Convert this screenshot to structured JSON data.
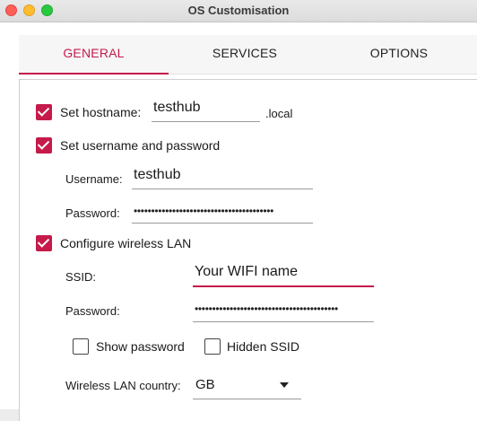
{
  "window": {
    "title": "OS Customisation"
  },
  "tabs": [
    {
      "label": "GENERAL",
      "active": true
    },
    {
      "label": "SERVICES",
      "active": false
    },
    {
      "label": "OPTIONS",
      "active": false
    }
  ],
  "accent_color": "#c51a4a",
  "hostname": {
    "label": "Set hostname:",
    "checked": true,
    "value": "testhub",
    "suffix": ".local"
  },
  "user": {
    "label": "Set username and password",
    "checked": true,
    "username_label": "Username:",
    "username_value": "testhub",
    "password_label": "Password:",
    "password_value": "••••••••••••••••••••••••••••••••••••••••"
  },
  "wlan": {
    "label": "Configure wireless LAN",
    "checked": true,
    "ssid_label": "SSID:",
    "ssid_value": "Your WIFI name",
    "password_label": "Password:",
    "password_value": "•••••••••••••••••••••••••••••••••••••••••",
    "show_password_label": "Show password",
    "show_password_checked": false,
    "hidden_ssid_label": "Hidden SSID",
    "hidden_ssid_checked": false,
    "country_label": "Wireless LAN country:",
    "country_value": "GB"
  }
}
